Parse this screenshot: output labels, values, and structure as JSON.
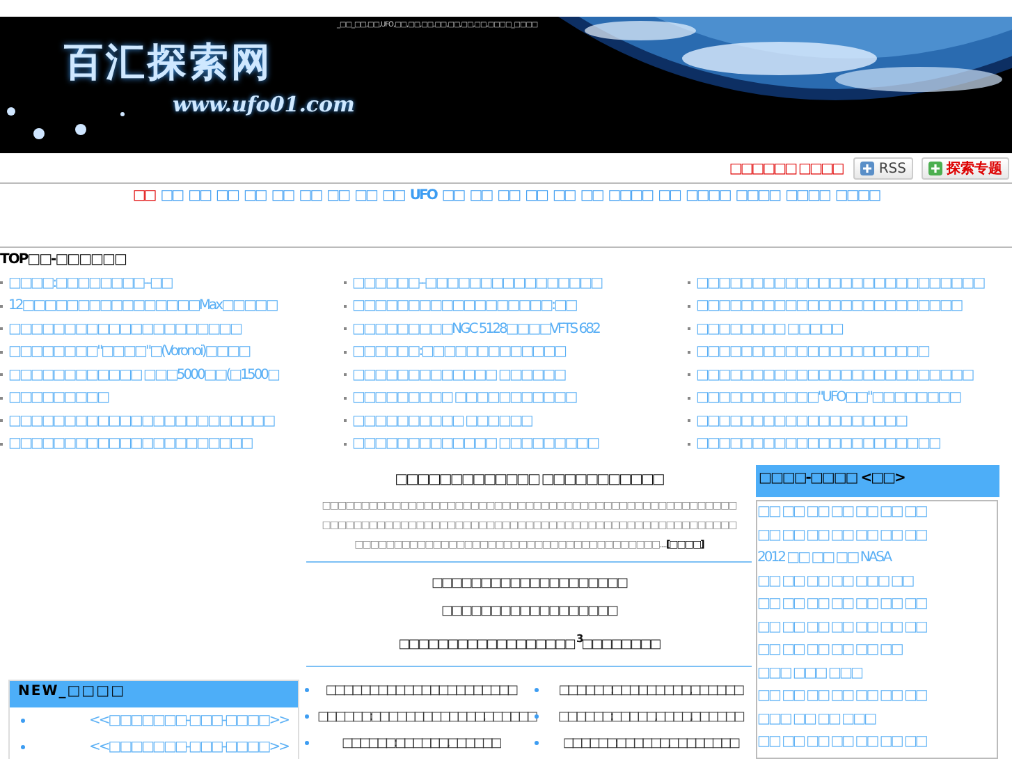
{
  "banner": {
    "keywords": "_□□_□□,□□,UFO,□□,□□,□□,□□,□□,□□,□□,□□□□_□□□□",
    "logo": "百汇探索网",
    "url": "www.ufo01.com"
  },
  "toolbar": {
    "notice": "□□□□□□ □□□□",
    "buttons": [
      {
        "label": "RSS",
        "kind": "rss"
      },
      {
        "label": "探索专题",
        "kind": "topic"
      }
    ]
  },
  "nav": [
    {
      "label": "□□",
      "selected": true
    },
    {
      "label": "□□",
      "selected": false
    },
    {
      "label": "□□",
      "selected": false
    },
    {
      "label": "□□",
      "selected": false
    },
    {
      "label": "□□",
      "selected": false
    },
    {
      "label": "□□",
      "selected": false
    },
    {
      "label": "□□",
      "selected": false
    },
    {
      "label": "□□",
      "selected": false
    },
    {
      "label": "□□",
      "selected": false
    },
    {
      "label": "□□",
      "selected": false
    },
    {
      "label": "UFO",
      "selected": false
    },
    {
      "label": "□□",
      "selected": false
    },
    {
      "label": "□□",
      "selected": false
    },
    {
      "label": "□□",
      "selected": false
    },
    {
      "label": "□□",
      "selected": false
    },
    {
      "label": "□□",
      "selected": false
    },
    {
      "label": "□□",
      "selected": false
    },
    {
      "label": "□□□□",
      "selected": false
    },
    {
      "label": "□□",
      "selected": false
    },
    {
      "label": "□□□□",
      "selected": false
    },
    {
      "label": "□□□□",
      "selected": false
    },
    {
      "label": "□□□□",
      "selected": false
    },
    {
      "label": "□□□□",
      "selected": false
    }
  ],
  "top": {
    "title": "TOP□□-□□□□□□",
    "columns": [
      [
        "□□□□:□□□□□□□□--□□",
        "12□□□□□□□□□□□□□□□□Max□□□□□",
        "□□□□□□□□□□□□□□□□□□□□□",
        "□□□□□□□□\"□□□□\"□(Voronoi)□□□□",
        "□□□□□□□□□□□□ □□□5000□□(□1500□",
        "□□□□□□□□□",
        "□□□□□□□□□□□□□□□□□□□□□□□□",
        "□□□□□□□□□□□□□□□□□□□□□□"
      ],
      [
        "□□□□□□--□□□□□□□□□□□□□□□□",
        "□□□□□□□□□□□□□□□□□□:□□",
        "□□□□□□□□□NGC 5128□□□□VFTS 682",
        "□□□□□□:□□□□□□□□□□□□□",
        "□□□□□□□□□□□□□ □□□□□□",
        "□□□□□□□□□ □□□□□□□□□□□",
        "□□□□□□□□□□ □□□□□□",
        "□□□□□□□□□□□□□ □□□□□□□□□"
      ],
      [
        "□□□□□□□□□□□□□□□□□□□□□□□□□□",
        "□□□□□□□□□□□□□□□□□□□□□□□□",
        "□□□□□□□□ □□□□□",
        "□□□□□□□□□□□□□□□□□□□□□",
        "□□□□□□□□□□□□□□□□□□□□□□□□□",
        "□□□□□□□□□□□\"UFO□□\"□□□□□□□□",
        "□□□□□□□□□□□□□□□□□□□",
        "□□□□□□□□□□□□□□□□□□□□□□"
      ]
    ]
  },
  "new_box": {
    "title": "NEW_□□□□",
    "items": [
      "<<□□□□□□□-□□□-□□□□>>",
      "<<□□□□□□□-□□□-□□□□>>"
    ]
  },
  "feature": {
    "headline": "□□□□□□□□□□□□□ □□□□□□□□□□□",
    "summary": "□□□□□□□□□□□□□□□□□□□□□□□□□□□□□□□□□□□□□□□□□□□□□□□□□□□□□□□□□□□□□□□□□□□□□□□□□□□□□□□□□□□□□□□□□□□□□□□□□□□□□□□□□□□□□□□□□□□□□□□□□□□□□□□□□□□□□□□□□□□□□□□□□....",
    "more": "[□□□□]"
  },
  "headlines": [
    "□□□□□□□□□□□□□□□□□□□□",
    "□□□□□□□□□□□□□□□□□□",
    "□□□□□□□□□□□□□□□□□□ $^{3}$□□□□□□□□"
  ],
  "articles": [
    "□□□□□□□□□□□□□□□□□□□□□□",
    "□□□□□□:□□□□□□□□□,□□□□□□",
    "□□□□□□:□□□□□□□□□□□□□,□□□□□□",
    "□□□□□□:□□□□□,□□□□,□□□□□□",
    "□□□□□□:□□□□□□,□□□□□□",
    "□□□□□□:□□□□□□,□□□□□□□□"
  ],
  "side_box": {
    "title": "□□□□-□□□□ <□□>",
    "items": [
      "□□ □□ □□ □□ □□ □□ □□",
      "□□ □□ □□ □□ □□ □□ □□",
      "2012 □□ □□ □□ NASA",
      "□□ □□ □□ □□ □□□ □□",
      "□□ □□ □□ □□ □□ □□ □□",
      "□□ □□ □□ □□ □□ □□ □□",
      "□□ □□ □□ □□ □□ □□",
      "□□□ □□□ □□□",
      "□□ □□ □□ □□ □□ □□ □□",
      "□□□ □□ □□ □□□",
      "□□ □□ □□ □□ □□ □□ □□"
    ]
  }
}
